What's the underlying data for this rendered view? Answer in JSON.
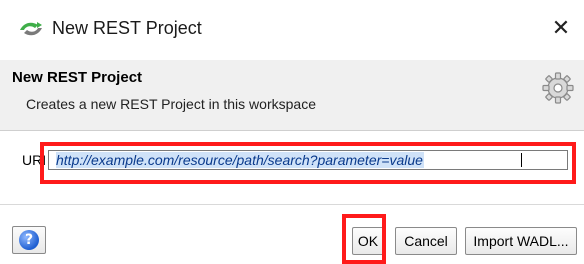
{
  "window": {
    "title": "New REST Project",
    "close_symbol": "✕"
  },
  "banner": {
    "title": "New REST Project",
    "description": "Creates a new REST Project in this workspace",
    "icon": "gear-icon"
  },
  "form": {
    "uri_label": "URI",
    "uri_value": "http://example.com/resource/path/search?parameter=value"
  },
  "buttons": {
    "help_symbol": "?",
    "ok": "OK",
    "cancel": "Cancel",
    "import_wadl": "Import WADL..."
  },
  "colors": {
    "highlight_red": "#ff1a1a",
    "selection_blue": "#cfe2f8",
    "uri_text": "#0a3a8c"
  }
}
